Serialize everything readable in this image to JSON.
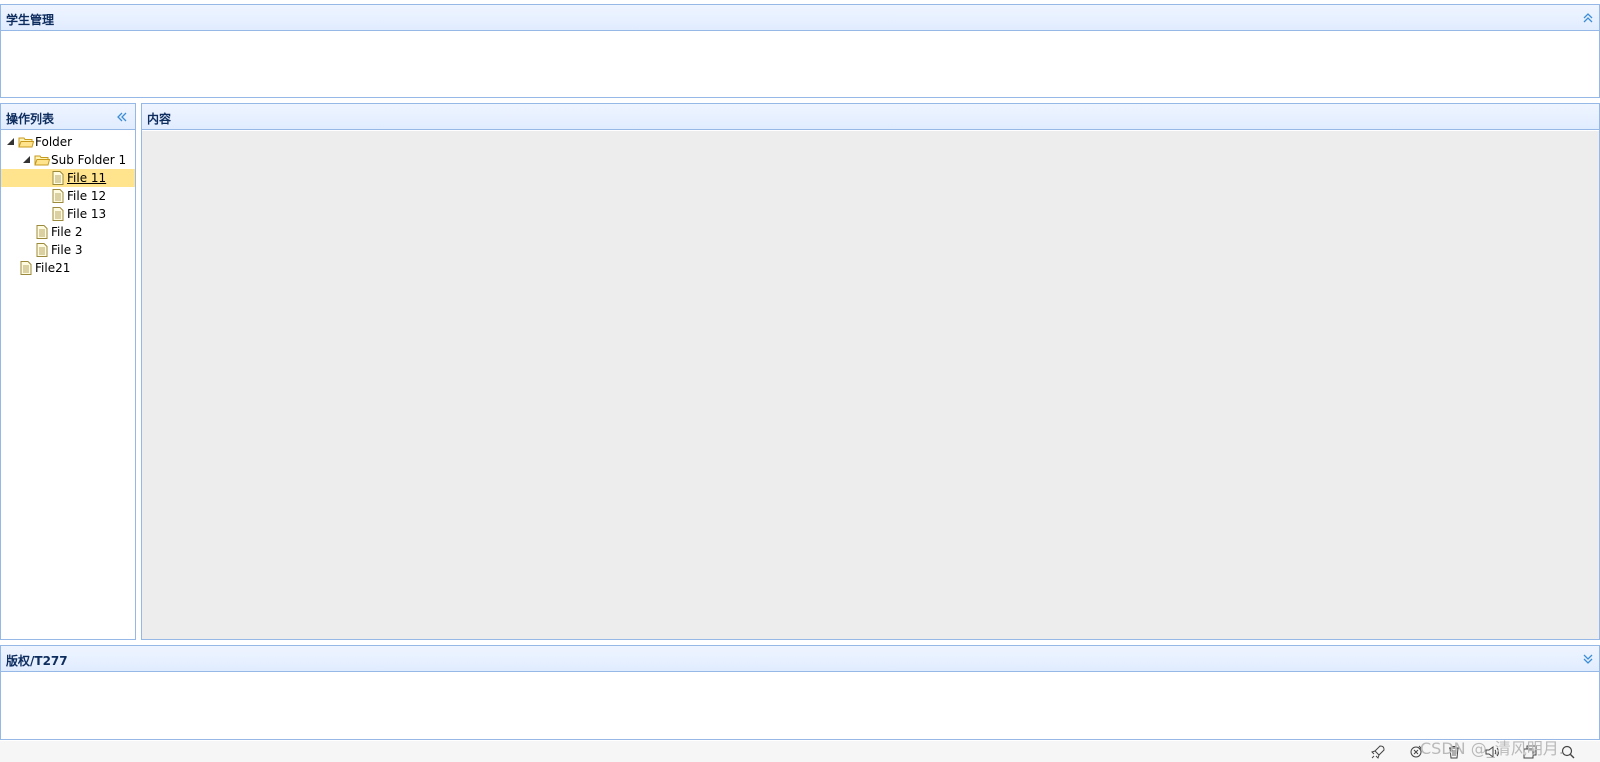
{
  "north": {
    "title": "学生管理"
  },
  "west": {
    "title": "操作列表",
    "tree": [
      {
        "label": "Folder"
      },
      {
        "label": "Sub Folder 1"
      },
      {
        "label": "File 11"
      },
      {
        "label": "File 12"
      },
      {
        "label": "File 13"
      },
      {
        "label": "File 2"
      },
      {
        "label": "File 3"
      },
      {
        "label": "File21"
      }
    ]
  },
  "center": {
    "title": "内容"
  },
  "south": {
    "title": "版权/T277"
  },
  "watermark": "CSDN @_清风明月."
}
